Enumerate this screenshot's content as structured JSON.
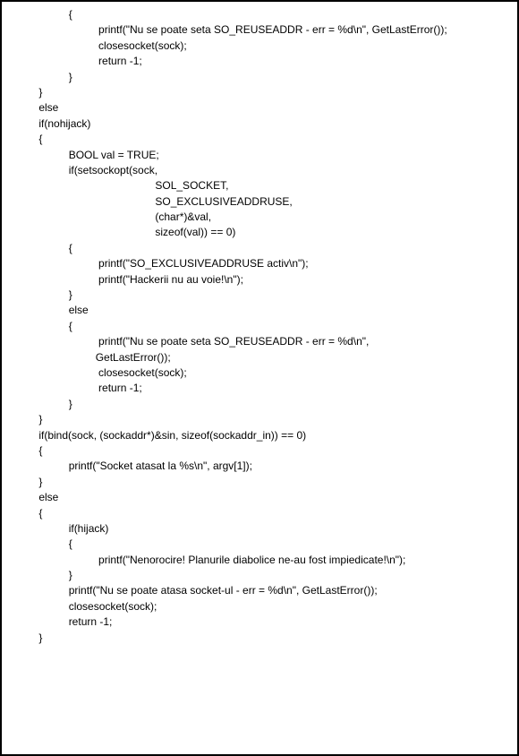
{
  "code": {
    "lines": [
      "                    {",
      "                              printf(\"Nu se poate seta SO_REUSEADDR - err = %d\\n\", GetLastError());",
      "                              closesocket(sock);",
      "                              return -1;",
      "                    }",
      "          }",
      "          else",
      "          if(nohijack)",
      "          {",
      "                    BOOL val = TRUE;",
      "                    if(setsockopt(sock,",
      "                                                 SOL_SOCKET,",
      "                                                 SO_EXCLUSIVEADDRUSE,",
      "                                                 (char*)&val,",
      "                                                 sizeof(val)) == 0)",
      "                    {",
      "                              printf(\"SO_EXCLUSIVEADDRUSE activ\\n\");",
      "                              printf(\"Hackerii nu au voie!\\n\");",
      "                    }",
      "                    else",
      "                    {",
      "                              printf(\"Nu se poate seta SO_REUSEADDR - err = %d\\n\",",
      "                             GetLastError());",
      "                              closesocket(sock);",
      "                              return -1;",
      "                    }",
      "          }",
      "",
      "          if(bind(sock, (sockaddr*)&sin, sizeof(sockaddr_in)) == 0)",
      "          {",
      "                    printf(\"Socket atasat la %s\\n\", argv[1]);",
      "          }",
      "          else",
      "          {",
      "                    if(hijack)",
      "                    {",
      "                              printf(\"Nenorocire! Planurile diabolice ne-au fost impiedicate!\\n\");",
      "                    }",
      "",
      "                    printf(\"Nu se poate atasa socket-ul - err = %d\\n\", GetLastError());",
      "                    closesocket(sock);",
      "                    return -1;",
      "          }"
    ]
  }
}
